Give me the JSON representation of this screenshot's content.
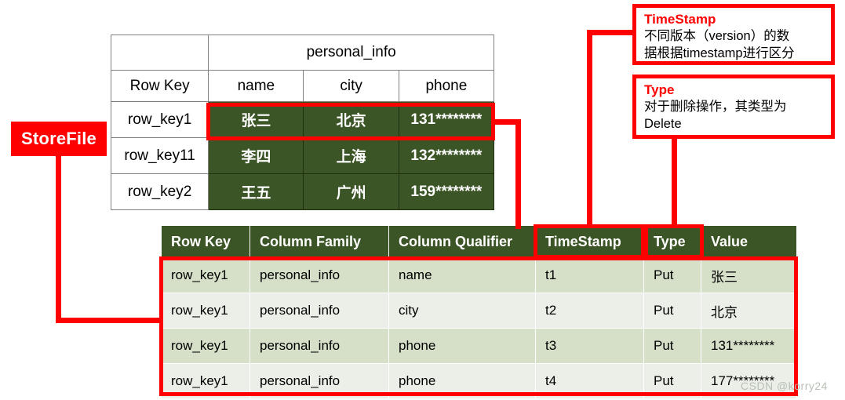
{
  "labels": {
    "storefile": "StoreFile"
  },
  "top_table": {
    "column_family_header": "personal_info",
    "row_key_header": "Row Key",
    "columns": [
      "name",
      "city",
      "phone"
    ],
    "rows": [
      {
        "row_key": "row_key1",
        "name": "张三",
        "city": "北京",
        "phone": "131********"
      },
      {
        "row_key": "row_key11",
        "name": "李四",
        "city": "上海",
        "phone": "132********"
      },
      {
        "row_key": "row_key2",
        "name": "王五",
        "city": "广州",
        "phone": "159********"
      }
    ]
  },
  "bottom_table": {
    "headers": [
      "Row Key",
      "Column Family",
      "Column Qualifier",
      "TimeStamp",
      "Type",
      "Value"
    ],
    "rows": [
      {
        "row_key": "row_key1",
        "column_family": "personal_info",
        "column_qualifier": "name",
        "timestamp": "t1",
        "type": "Put",
        "value": "张三"
      },
      {
        "row_key": "row_key1",
        "column_family": "personal_info",
        "column_qualifier": "city",
        "timestamp": "t2",
        "type": "Put",
        "value": "北京"
      },
      {
        "row_key": "row_key1",
        "column_family": "personal_info",
        "column_qualifier": "phone",
        "timestamp": "t3",
        "type": "Put",
        "value": "131********"
      },
      {
        "row_key": "row_key1",
        "column_family": "personal_info",
        "column_qualifier": "phone",
        "timestamp": "t4",
        "type": "Put",
        "value": "177********"
      }
    ]
  },
  "callouts": [
    {
      "title": "TimeStamp",
      "body": "不同版本（version）的数\n据根据timestamp进行区分"
    },
    {
      "title": "Type",
      "body": "对于删除操作，其类型为\nDelete"
    }
  ],
  "watermark": "CSDN @korry24",
  "colors": {
    "accent_red": "#fe0000",
    "dark_green": "#3c5526",
    "row_odd": "#d6e0c9",
    "row_even": "#ebefe8",
    "grid_gray": "#808080"
  }
}
